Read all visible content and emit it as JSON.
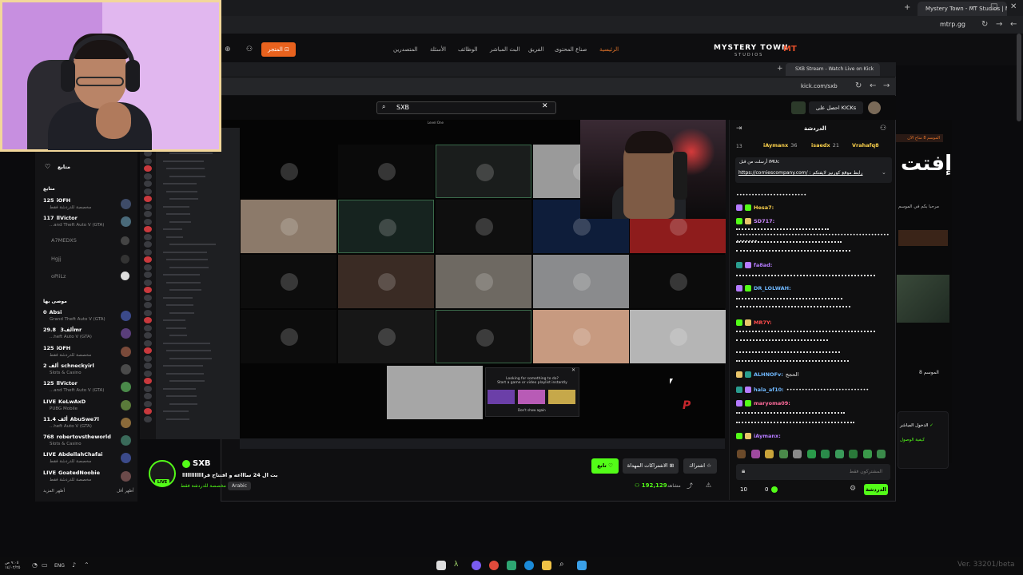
{
  "outer_browser": {
    "tab_title": "Mystery Town - MT Studios | M...",
    "url": "mtrp.gg",
    "version": "Ver. 33201/beta"
  },
  "site": {
    "logo": "MYSTERY TOWN",
    "logo_sub": "STUDIOS",
    "logo_mark": "MT",
    "nav": [
      "الرئيسية",
      "صناع المحتوى",
      "الفريق",
      "البث المباشر",
      "الوظائف",
      "الأسئلة",
      "المتصدرين"
    ],
    "store_label": "المتجر",
    "right_big": "إفتت",
    "season_badge": "الموسم 8 متاح الآن",
    "welcome": "مرحبا بكم في الموسم",
    "season8": "الموسم 8",
    "login_label": "الدخول المباشر",
    "login_sub": "كيفية الوصول"
  },
  "inner_browser": {
    "tab_title": "SXB Stream - Watch Live on Kick",
    "url": "kick.com/sxb"
  },
  "kick": {
    "search_value": "SXB",
    "cta": "احصل على KICKs",
    "stream_badge": "Level One"
  },
  "sidebar": {
    "following_title": "متابع",
    "following_label": "متابع",
    "following": [
      {
        "count": "125",
        "name": "iOFH",
        "sub": "مخصصة للدردشة فقط"
      },
      {
        "count": "117",
        "name": "llVictor",
        "sub": "...and Theft Auto V (GTA)"
      }
    ],
    "offline": [
      "A7MEDXS",
      "Hgjj",
      "oPiiLz"
    ],
    "recommended_title": "موصى بها",
    "recommended": [
      {
        "count": "0",
        "name": "Absi",
        "sub": "Grand Theft Auto V (GTA)"
      },
      {
        "count": "29.8 ألف",
        "name": "3mr",
        "sub": "...heft Auto V (GTA)"
      },
      {
        "count": "125",
        "name": "iOFH",
        "sub": "مخصصة للدردشة فقط"
      },
      {
        "count": "2 ألف",
        "name": "schneckyirl",
        "sub": "Slots & Casino"
      },
      {
        "count": "125",
        "name": "llVictor",
        "sub": "...and Theft Auto V (GTA)"
      },
      {
        "count": "LIVE",
        "name": "KeLwAxD",
        "sub": "PUBG Mobile"
      },
      {
        "count": "11.4 ألف",
        "name": "AbuSwe7l",
        "sub": "...heft Auto V (GTA)"
      },
      {
        "count": "768",
        "name": "robertovstheworld",
        "sub": "Slots & Casino"
      },
      {
        "count": "LIVE",
        "name": "AbdellahChafai",
        "sub": "مخصصة للدردشة فقط"
      },
      {
        "count": "LIVE",
        "name": "GoatedNoobie",
        "sub": "مخصصة للدردشة فقط"
      }
    ],
    "show_more": "أظهر المزيد",
    "show_less": "أظهر أقل"
  },
  "popup": {
    "line1": "Looking for something to do?",
    "line2": "Start a game or video playlist instantly",
    "dont_show": "Don't show again"
  },
  "channel": {
    "name": "SXB",
    "live": "LIVE",
    "title": "بث ال 24 ساااعه و افتتاح قراااااااااااا",
    "category": "مخصصة للدردشة فقط",
    "language": "Arabic",
    "follow": "تابع",
    "subs_gift": "الاشتراكات المهداة",
    "subscribe": "اشتراك",
    "viewers": "192,129",
    "viewers_label": "مشاهد"
  },
  "chat": {
    "title": "الدردشة",
    "top_gifters": [
      {
        "name": "iAymanx",
        "count": "36"
      },
      {
        "name": "isaedx",
        "count": "21"
      },
      {
        "name": "Vrahafq8",
        "count": ""
      }
    ],
    "top_count": "13",
    "pinned_by": "أرسلت من قبل iMUc",
    "pinned_text": ": رابط موقع كورنيز لايفتكم",
    "pinned_link": "https://corniescompany.com/",
    "messages": [
      {
        "user": "",
        "text": "•••••••••••••••••••••••",
        "color": "#ffffff"
      },
      {
        "user": "Hesa7:",
        "text": "",
        "color": "#fbd14b"
      },
      {
        "user": "SD717:",
        "text": "",
        "color": "#d08aff"
      },
      {
        "user": "",
        "text": "•••••••••••••••••••••••••••••••••••••••••••••••••••••••••",
        "color": "#ffffff"
      },
      {
        "user": "fa8ad:",
        "text": "",
        "color": "#b57bff"
      },
      {
        "user": "DR_LOLWAH:",
        "text": "",
        "color": "#6fb8ff"
      },
      {
        "user": "MR7Y:",
        "text": "",
        "color": "#ff4b4b"
      },
      {
        "user": "ALHNOFv:",
        "text": "الحجج",
        "color": "#6fb8ff"
      },
      {
        "user": "hala_af10:",
        "text": "•••••••••••••••••••••••••••",
        "color": "#6fb8ff"
      },
      {
        "user": "maryoma09:",
        "text": "",
        "color": "#ff6b9b"
      },
      {
        "user": "iAymanx:",
        "text": "",
        "color": "#b57bff"
      }
    ],
    "input_placeholder": "المشتركون فقط",
    "send": "الدردشة",
    "kicks_count": "0",
    "points_count": "10"
  },
  "taskbar": {
    "lang": "ENG",
    "time": "٩:٠٥ ص",
    "date": "١٤/٠٢/٢٥"
  }
}
